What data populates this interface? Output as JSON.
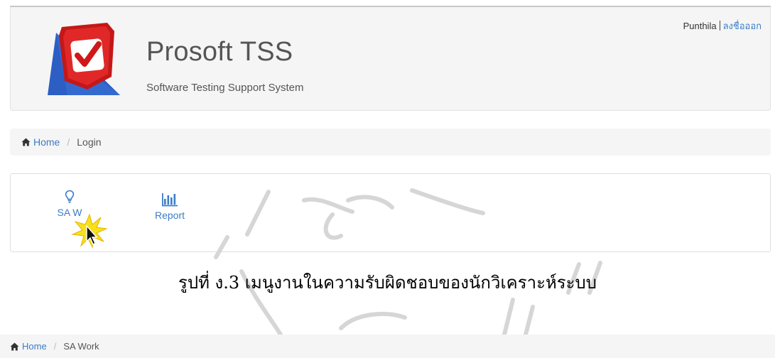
{
  "header": {
    "app_title": "Prosoft TSS",
    "app_subtitle": "Software Testing Support System",
    "logo_icon": "shield-checkmark-icon",
    "user_name": "Punthila",
    "logout_label": "ลงชื่อออก"
  },
  "breadcrumb_top": {
    "home_label": "Home",
    "current": "Login"
  },
  "menu": {
    "items": [
      {
        "label": "SA Work",
        "icon": "lightbulb-icon"
      },
      {
        "label": "Report",
        "icon": "bar-chart-icon"
      }
    ],
    "sa_visible_label": "SA W"
  },
  "caption": "รูปที่ ง.3 เมนูงานในความรับผิดชอบของนักวิเคราะห์ระบบ",
  "breadcrumb_bottom": {
    "home_label": "Home",
    "current": "SA Work"
  },
  "colors": {
    "link": "#3a7cc7",
    "panel_bg": "#f5f5f5",
    "logo_red": "#e02020",
    "logo_blue": "#2c5ec4"
  }
}
